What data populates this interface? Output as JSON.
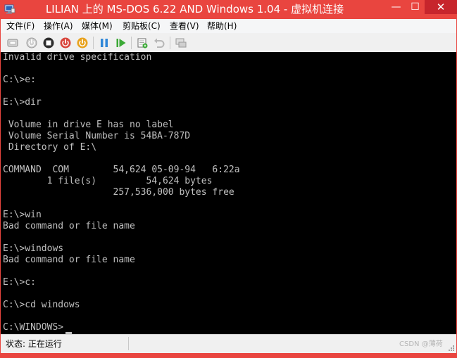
{
  "window": {
    "title": "LILIAN 上的 MS-DOS 6.22 AND Windows 1.04 - 虚拟机连接",
    "controls": {
      "minimize": "—",
      "maximize": "☐",
      "close": "✕"
    }
  },
  "menu": [
    "文件(F)",
    "操作(A)",
    "媒体(M)",
    "剪贴板(C)",
    "查看(V)",
    "帮助(H)"
  ],
  "toolbar": {
    "buttons": [
      "ctrl-alt-del-icon",
      "start-icon",
      "turn-off-icon",
      "shut-down-icon",
      "save-icon",
      "pause-icon",
      "reset-icon",
      "snapshot-icon",
      "revert-icon",
      "enhanced-session-icon"
    ],
    "colors": {
      "power_red": "#d8453b",
      "power_orange": "#e8a21d",
      "pause_blue": "#2f87d8",
      "reset_green": "#3ba936"
    }
  },
  "console": {
    "lines": [
      "Invalid drive specification",
      "",
      "C:\\>e:",
      "",
      "E:\\>dir",
      "",
      " Volume in drive E has no label",
      " Volume Serial Number is 54BA-787D",
      " Directory of E:\\",
      "",
      "COMMAND  COM        54,624 05-09-94   6:22a",
      "        1 file(s)         54,624 bytes",
      "                    257,536,000 bytes free",
      "",
      "E:\\>win",
      "Bad command or file name",
      "",
      "E:\\>windows",
      "Bad command or file name",
      "",
      "E:\\>c:",
      "",
      "C:\\>cd windows",
      "",
      "C:\\WINDOWS>"
    ],
    "colors": {
      "background": "#000000",
      "text": "#c0c0c0"
    }
  },
  "status": {
    "text": "状态: 正在运行",
    "watermark": "CSDN @薄荷"
  },
  "theme": {
    "titlebar": "#e9453f",
    "close_button": "#c7252c"
  }
}
